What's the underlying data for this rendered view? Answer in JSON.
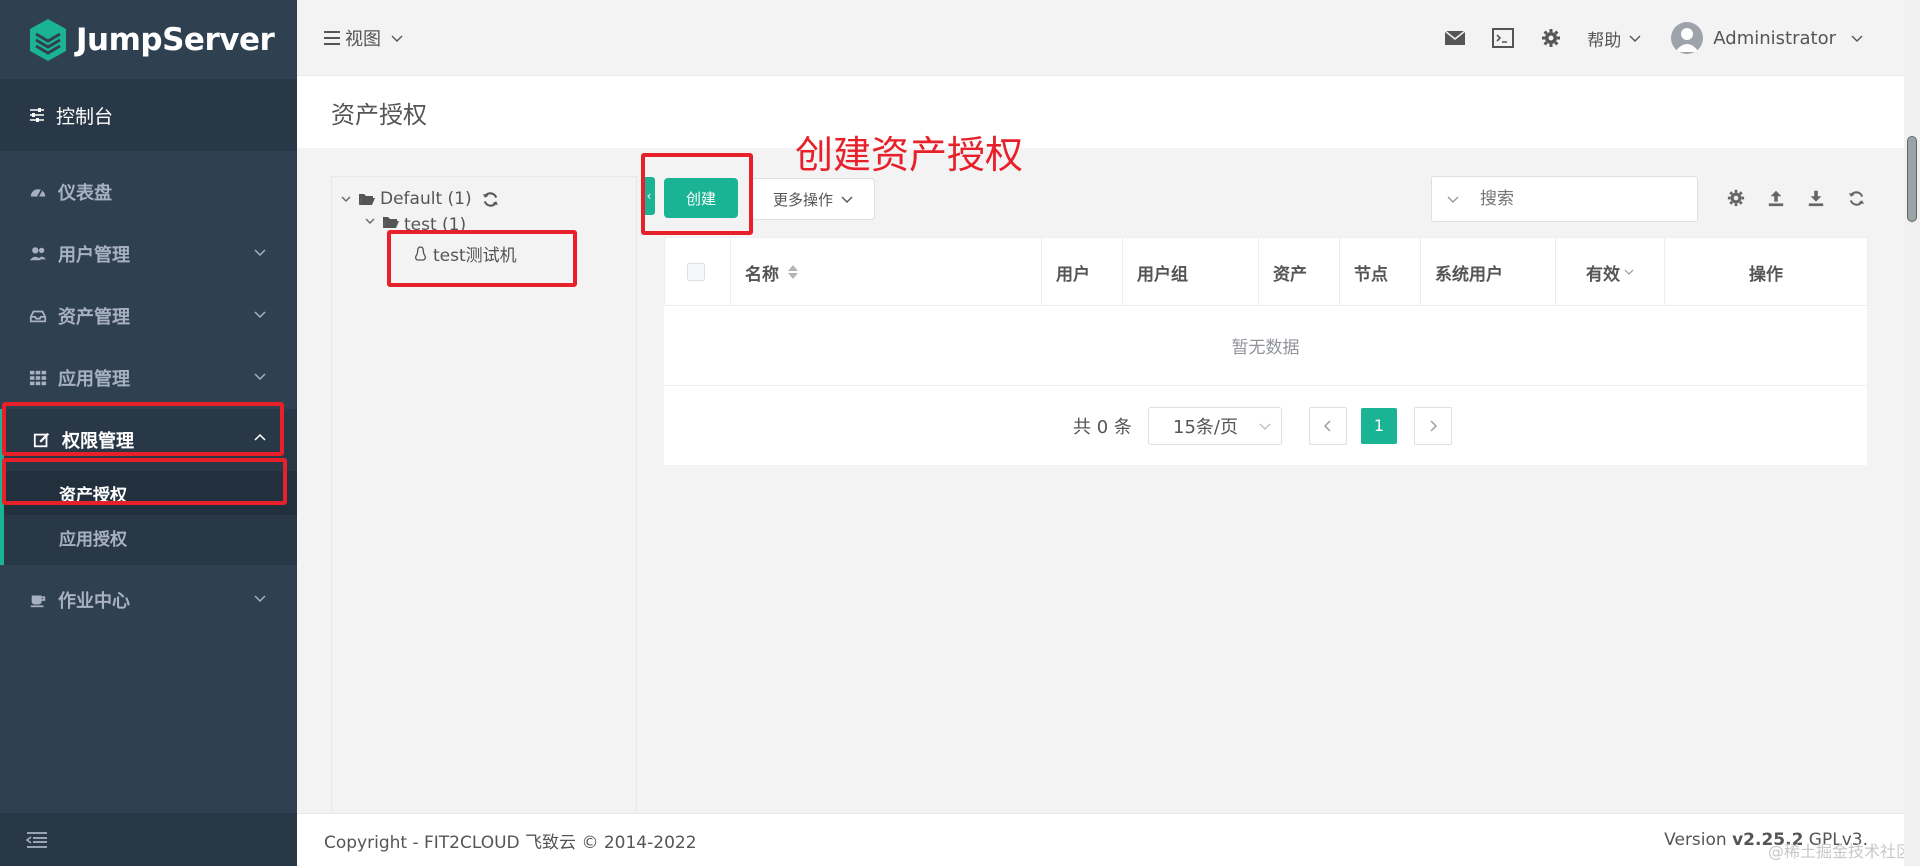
{
  "app": {
    "brand": "JumpServer"
  },
  "sidebar": {
    "console": "控制台",
    "items": [
      {
        "label": "仪表盘"
      },
      {
        "label": "用户管理"
      },
      {
        "label": "资产管理"
      },
      {
        "label": "应用管理"
      },
      {
        "label": "权限管理"
      },
      {
        "label": "作业中心"
      }
    ],
    "sub_items": [
      {
        "label": "资产授权"
      },
      {
        "label": "应用授权"
      }
    ]
  },
  "header": {
    "view": "视图",
    "help": "帮助",
    "user": "Administrator"
  },
  "page": {
    "title": "资产授权"
  },
  "tree": {
    "root": "Default (1)",
    "child": "test (1)",
    "leaf": "test测试机"
  },
  "toolbar": {
    "create": "创建",
    "more": "更多操作",
    "search_placeholder": "搜索"
  },
  "table": {
    "columns": [
      "名称",
      "用户",
      "用户组",
      "资产",
      "节点",
      "系统用户",
      "有效",
      "操作"
    ],
    "empty_text": "暂无数据"
  },
  "pagination": {
    "total": "共 0 条",
    "page_size": "15条/页",
    "current": "1"
  },
  "footer": {
    "copyright": "Copyright - FIT2CLOUD 飞致云 © 2014-2022",
    "version_prefix": "Version ",
    "version_num": "v2.25.2",
    "license": " GPLv3."
  },
  "watermark": "@稀土掘金技术社区",
  "annotation": {
    "text": "创建资产授权"
  },
  "colors": {
    "accent": "#1ab394",
    "sidebar": "#2f4050",
    "annotation": "#e8202a"
  }
}
